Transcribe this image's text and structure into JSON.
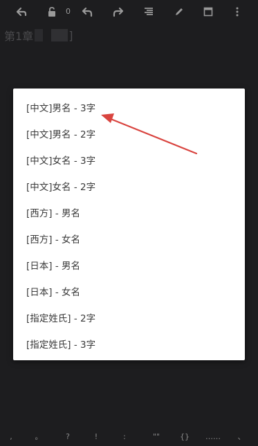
{
  "toolbar": {
    "counter": "0",
    "icons": [
      "back-icon",
      "unlock-icon",
      "undo-icon",
      "redo-icon",
      "align-icon",
      "pencil-icon",
      "window-icon",
      "more-vert-icon"
    ]
  },
  "title": {
    "prefix": "第1章",
    "bracket": "]"
  },
  "dialog": {
    "options": [
      "[中文]男名 - 3字",
      "[中文]男名 - 2字",
      "[中文]女名 - 3字",
      "[中文]女名 - 2字",
      "[西方] - 男名",
      "[西方] - 女名",
      "[日本] - 男名",
      "[日本] - 女名",
      "[指定姓氏] - 2字",
      "[指定姓氏] - 3字"
    ]
  },
  "colors": {
    "background": "#1d1d1f",
    "dialog": "#ffffff",
    "arrow": "#d9443f"
  },
  "bottom_keys": [
    ",",
    "。",
    "?",
    "!",
    ":",
    "\"\"",
    "{}",
    "……",
    "、"
  ]
}
